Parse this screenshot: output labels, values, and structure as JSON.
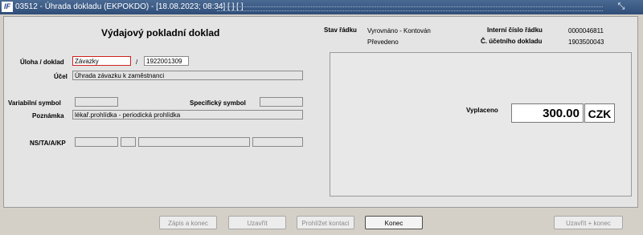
{
  "window": {
    "title": "03512 - Úhrada dokladu (EKPOKDO) - [18.08.2023; 08:34] [ ] [ ]",
    "icon_glyph": "IF",
    "resize_glyph": "⤡"
  },
  "form": {
    "heading": "Výdajový pokladní doklad",
    "uloha_label": "Úloha / doklad",
    "uloha_value": "Závazky",
    "slash": "/",
    "doklad_value": "1922001309",
    "ucel_label": "Účel",
    "ucel_value": "Úhrada závazku k zaměstnanci",
    "var_symbol_label": "Variabilní symbol",
    "var_symbol_value": "",
    "spec_symbol_label": "Specifický symbol",
    "spec_symbol_value": "",
    "poznamka_label": "Poznámka",
    "poznamka_value": "lékař.prohlídka - periodická prohlídka",
    "ns_label": "NS/TA/A/KP"
  },
  "status": {
    "stav_label": "Stav řádku",
    "stav_value1": "Vyrovnáno - Kontován",
    "stav_value2": "Převedeno",
    "interni_label": "Interní číslo řádku",
    "interni_value": "0000046811",
    "ucetni_label": "Č. účetního dokladu",
    "ucetni_value": "1903500043"
  },
  "payment": {
    "label": "Vyplaceno",
    "amount": "300.00",
    "currency": "CZK"
  },
  "buttons": {
    "zapis": "Zápis a konec",
    "uzavrit": "Uzavřít",
    "prohlizet": "Prohlížet kontaci",
    "konec": "Konec",
    "uzavrit_konec": "Uzavřít + konec"
  }
}
